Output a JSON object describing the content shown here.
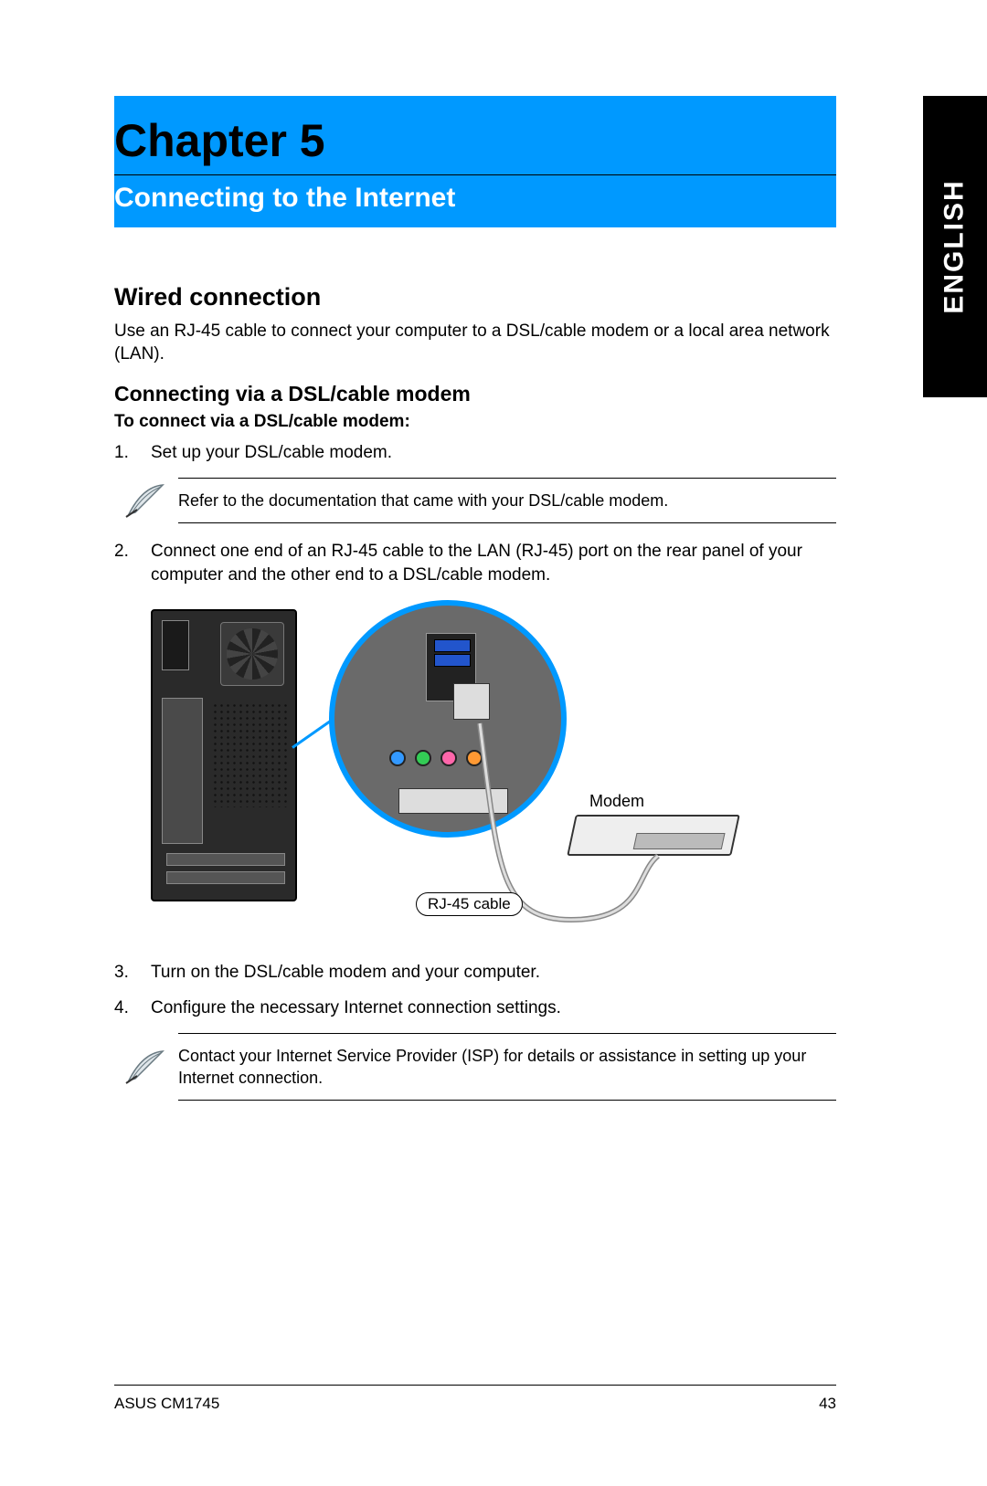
{
  "sideTab": "ENGLISH",
  "chapter": {
    "title": "Chapter 5",
    "subtitle": "Connecting to the Internet"
  },
  "section1": {
    "heading": "Wired connection",
    "intro": "Use an RJ-45 cable to connect your computer to a DSL/cable modem or a local area network (LAN)."
  },
  "section2": {
    "heading": "Connecting via a DSL/cable modem",
    "subheading": "To connect via a DSL/cable modem:"
  },
  "steps": {
    "n1": "1.",
    "t1": "Set up your DSL/cable modem.",
    "n2": "2.",
    "t2": "Connect one end of an RJ-45 cable to the LAN (RJ-45) port on the rear panel of your computer and the other end to a DSL/cable modem.",
    "n3": "3.",
    "t3": "Turn on the DSL/cable modem and your computer.",
    "n4": "4.",
    "t4": "Configure the necessary Internet connection settings."
  },
  "notes": {
    "note1": "Refer to the documentation that came with your DSL/cable modem.",
    "note2": "Contact your Internet Service Provider (ISP) for details or assistance in setting up your Internet connection."
  },
  "diagramLabels": {
    "modem": "Modem",
    "rj45": "RJ-45 cable"
  },
  "footer": {
    "product": "ASUS CM1745",
    "page": "43"
  }
}
